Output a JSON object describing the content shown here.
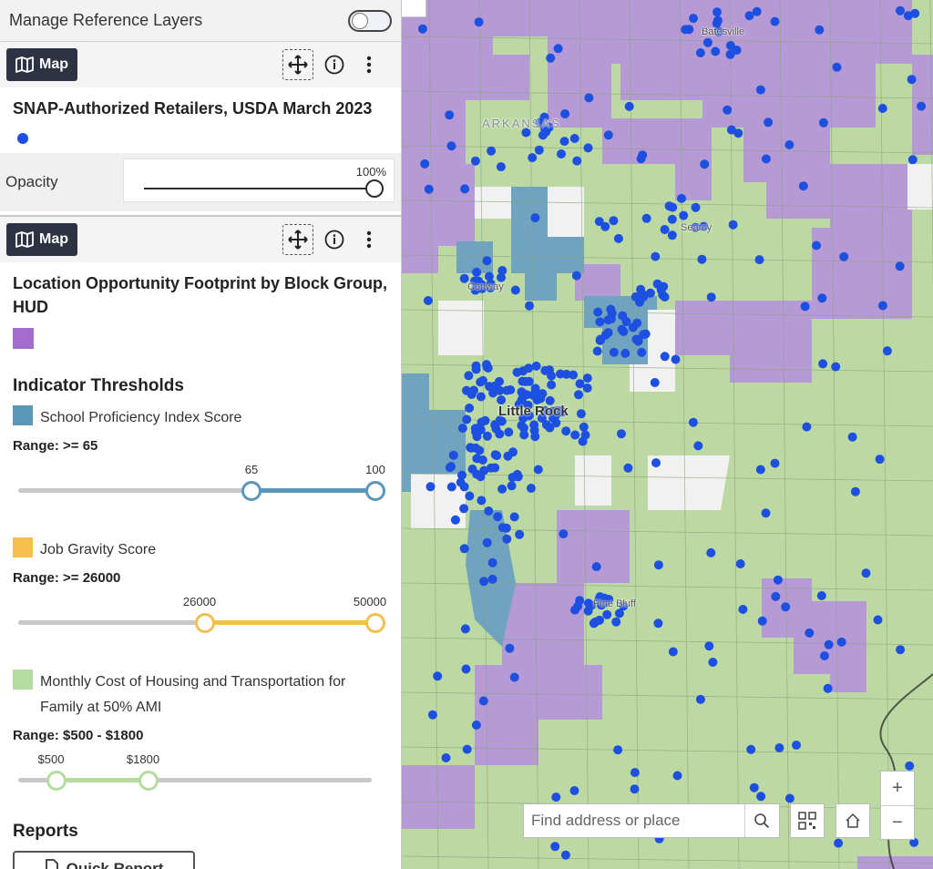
{
  "manager": {
    "title": "Manage Reference Layers",
    "toggle_on": false
  },
  "layer1": {
    "map_button": "Map",
    "title": "SNAP-Authorized Retailers, USDA March 2023",
    "dot_color": "#1d4fe0",
    "opacity_label": "Opacity",
    "opacity_value": "100%",
    "opacity_level": 1.0
  },
  "layer2": {
    "map_button": "Map",
    "title": "Location Opportunity Footprint by Block Group, HUD",
    "swatch_color": "#a56ccf",
    "thresholds_title": "Indicator Thresholds",
    "indicators": [
      {
        "label": "School Proficiency Index Score",
        "color": "#5b97b8",
        "range": "Range: >= 65",
        "min_label": "65",
        "max_label": "100",
        "lo": 65,
        "hi": 100,
        "scale": [
          0,
          100
        ]
      },
      {
        "label": "Job Gravity Score",
        "color": "#f5c04a",
        "range": "Range: >= 26000",
        "min_label": "26000",
        "max_label": "50000",
        "lo": 26000,
        "hi": 50000,
        "scale": [
          0,
          50000
        ]
      },
      {
        "label": "Monthly Cost of Housing and Transportation for Family at 50% AMI",
        "color": "#b5dca0",
        "range": "Range: $500 - $1800",
        "min_label": "$500",
        "max_label": "$1800"
      }
    ]
  },
  "reports": {
    "title": "Reports",
    "quick_report": "Quick Report"
  },
  "map": {
    "search_placeholder": "Find address or place",
    "zoom_in": "+",
    "zoom_out": "−",
    "places": [
      "Batesville",
      "ARKANSAS",
      "Searcy",
      "Conway",
      "Little Rock",
      "Pine Bluff"
    ],
    "colors": {
      "base": "#bcd9a3",
      "purple": "#b69ad6",
      "blue": "#6fa3c0",
      "white": "#f1f1f1",
      "dot": "#1d4fe0"
    }
  }
}
